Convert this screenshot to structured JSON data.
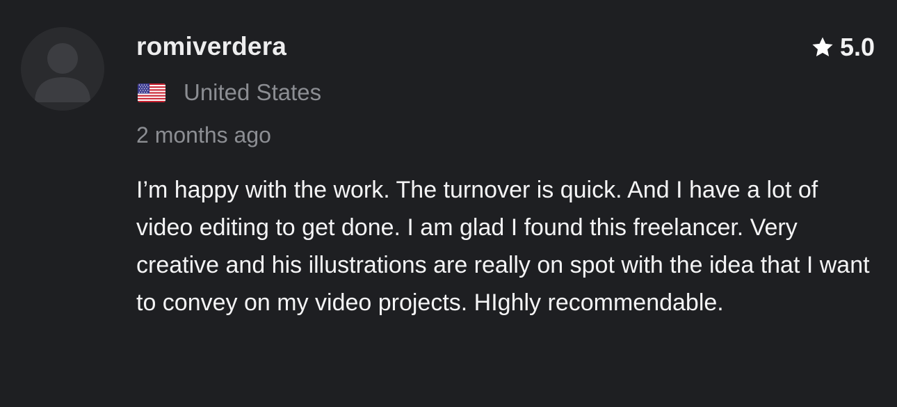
{
  "review": {
    "username": "romiverdera",
    "country": "United States",
    "country_flag": "us-flag-icon",
    "time_ago": "2 months ago",
    "rating": "5.0",
    "rating_icon": "star-icon",
    "text": "I’m happy with the work. The turnover is quick. And I have a lot of video editing to get done. I am glad I found this freelancer. Very creative and his illustrations are really on spot with the idea that I want to convey on my video projects. HIghly recommendable."
  },
  "colors": {
    "background": "#1e1f22",
    "avatar_bg": "#2a2b2e",
    "avatar_fg": "#3c3d41",
    "muted_text": "#8c8e93",
    "primary_text": "#f4f4f5"
  }
}
